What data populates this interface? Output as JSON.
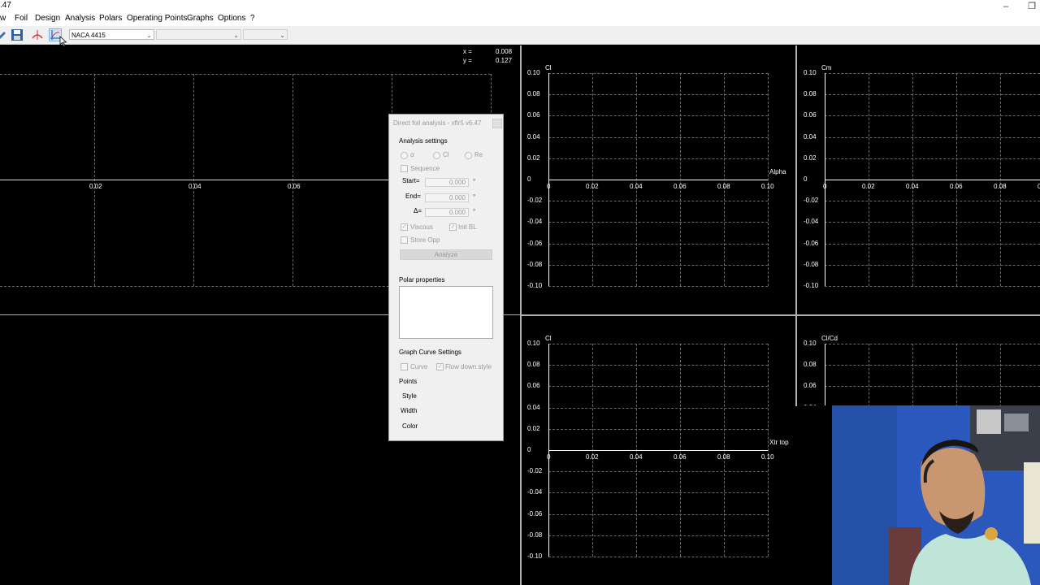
{
  "window": {
    "title": ".47",
    "buttons": {
      "minimize": "–",
      "maximize": "❐"
    }
  },
  "menu": [
    "w",
    "Foil",
    "Design",
    "Analysis",
    "Polars",
    "Operating Points",
    "Graphs",
    "Options",
    "?"
  ],
  "toolbar": {
    "foil_select": "NACA 4415",
    "polar_select": "",
    "opp_select": ""
  },
  "cursor_readout": {
    "x_label": "x  =",
    "x_value": "0.008",
    "y_label": "y  =",
    "y_value": "0.127"
  },
  "foil_view": {
    "x_ticks": [
      "0.02",
      "0.04",
      "0.06"
    ]
  },
  "graphs": {
    "y_ticks": [
      "0.10",
      "0.08",
      "0.06",
      "0.04",
      "0.02",
      "0",
      "-0.02",
      "-0.04",
      "-0.06",
      "-0.08",
      "-0.10"
    ],
    "x_ticks": [
      "0",
      "0.02",
      "0.04",
      "0.06",
      "0.08",
      "0.10"
    ],
    "g1": {
      "ylabel": "Cl",
      "xlabel": "Alpha"
    },
    "g2": {
      "ylabel": "Cm"
    },
    "g3": {
      "ylabel": "Cl",
      "xlabel": "Xtr top"
    },
    "g4": {
      "ylabel": "Cl/Cd"
    }
  },
  "dialog": {
    "title": "Direct foil analysis - xflr5 v6.47",
    "analysis_settings": "Analysis settings",
    "radio_alpha": "α",
    "radio_cl": "Cl",
    "radio_re": "Re",
    "sequence": "Sequence",
    "start_label": "Start=",
    "start_value": "0.000",
    "end_label": "End=",
    "end_value": "0.000",
    "delta_label": "Δ=",
    "delta_value": "0.000",
    "unit": "°",
    "viscous": "Viscous",
    "init_bl": "Init BL",
    "store_opp": "Store Opp",
    "analyze": "Analyze",
    "polar_properties": "Polar properties",
    "graph_curve_settings": "Graph Curve Settings",
    "curve": "Curve",
    "flow_down_style": "Flow down style",
    "points": "Points",
    "style": "Style",
    "width": "Width",
    "color": "Color"
  },
  "colors": {
    "background": "#000000",
    "grid": "#6a6a6a",
    "axis": "#ffffff",
    "dialog": "#f0f0f0"
  }
}
